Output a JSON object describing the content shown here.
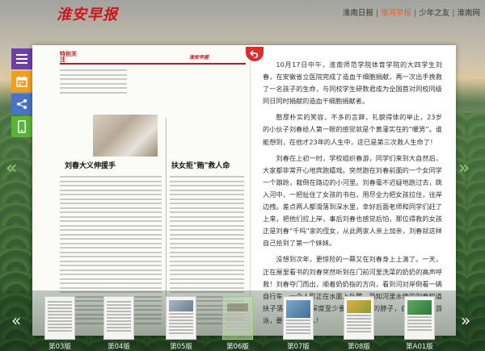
{
  "header": {
    "logo": "淮安早报",
    "links": [
      {
        "label": "淮南日报",
        "active": false
      },
      {
        "label": "淮河早报",
        "active": true
      },
      {
        "label": "少年之友",
        "active": false
      },
      {
        "label": "淮南网",
        "active": false
      }
    ]
  },
  "sidebar": {
    "buttons": [
      {
        "name": "menu-icon",
        "color": "#6e40a8"
      },
      {
        "name": "calendar-icon",
        "color": "#f0a020"
      },
      {
        "name": "share-icon",
        "color": "#4a72c8"
      },
      {
        "name": "mobile-icon",
        "color": "#5ab43c"
      }
    ]
  },
  "nav": {
    "prev": "«",
    "next": "»"
  },
  "page_thumb": {
    "section_label": "特别关注",
    "headline_left": "刘春大义伸援手",
    "headline_right": "扶女拒\"贿\"救人命"
  },
  "article": {
    "paragraphs": [
      "10月17日中午，淮南师范学院体育学院的大四学生刘春，在安徽省立医院完成了造血干细胞捐献，再一次出手挽救了一名孩子的生命，与同校学生研数君成为全国首对同校同级同日同时捐献的造血干细胞捐献者。",
      "憨厚朴实的笑容，不多的言辞，礼貌得体的举止，23岁的小伙子刘春给人第一眼的感觉就是个黄灌实在的“暖男”。谁能想到，在他才23年的人生中，这已是第三次救人生命了！",
      "刘春在上初一时，学校组织春游，同学们来到大自然后，大家都非常开心地宾跑嬉戏。突然跑在刘春前面的一个女同学一个踉跄，栽倒在路边的小河里。刘春毫不迟疑地跑过去，跳入河中，一把扯住了女孩的书包，用尽全力把女孩拉住，往岸边拽。差点两人都滑落到深水里，幸好后面老师和同学们赶了上来，把他们拉上岸，事后刘春也感觉后怕，那位得救的女孩正是刘春“千吗”家的侄女，从此两家人亲上加亲，刘春就这样自己拾到了第一个妹妹。",
      "没想到次年，更惊险的一幕又在刘春身上上演了。一天，正在屋里看书的刘春突然听到在门前河里洗菜的奶奶的高声呼救！刘春夺门而出，顺着奶奶指的方向，看到河对岸倒看一辆自行车，一个人影正在水面上扑腾。熟知河里水情的刘春知道扶子落水的地方深度至少要没过自己的脖子，自己也不会游泳，要想办法救人！"
    ]
  },
  "thumbnails": [
    {
      "label": "第03版",
      "active": false
    },
    {
      "label": "第04版",
      "active": false
    },
    {
      "label": "第05版",
      "active": false
    },
    {
      "label": "第06版",
      "active": true
    },
    {
      "label": "第07版",
      "active": false
    },
    {
      "label": "第08版",
      "active": false
    },
    {
      "label": "第A01版",
      "active": false
    }
  ]
}
